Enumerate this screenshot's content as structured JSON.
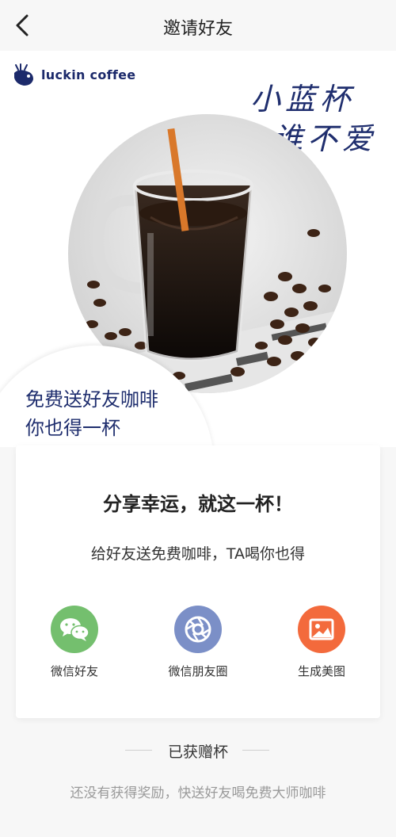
{
  "nav": {
    "title": "邀请好友"
  },
  "hero": {
    "logo_text": "luckin coffee",
    "slogan_line1": "小蓝杯",
    "slogan_line2": "谁不爱",
    "promo_line1": "免费送好友咖啡",
    "promo_line2": "你也得一杯"
  },
  "card": {
    "title": "分享幸运，就这一杯！",
    "subtitle": "给好友送免费咖啡，TA喝你也得",
    "share_options": [
      {
        "label": "微信好友",
        "icon": "wechat-icon",
        "color": "#74bf6e"
      },
      {
        "label": "微信朋友圈",
        "icon": "moments-icon",
        "color": "#7b8fc7"
      },
      {
        "label": "生成美图",
        "icon": "image-icon",
        "color": "#f36a3c"
      }
    ]
  },
  "rewards": {
    "heading": "已获赠杯",
    "empty_text": "还没有获得奖励，快送好友喝免费大师咖啡"
  }
}
